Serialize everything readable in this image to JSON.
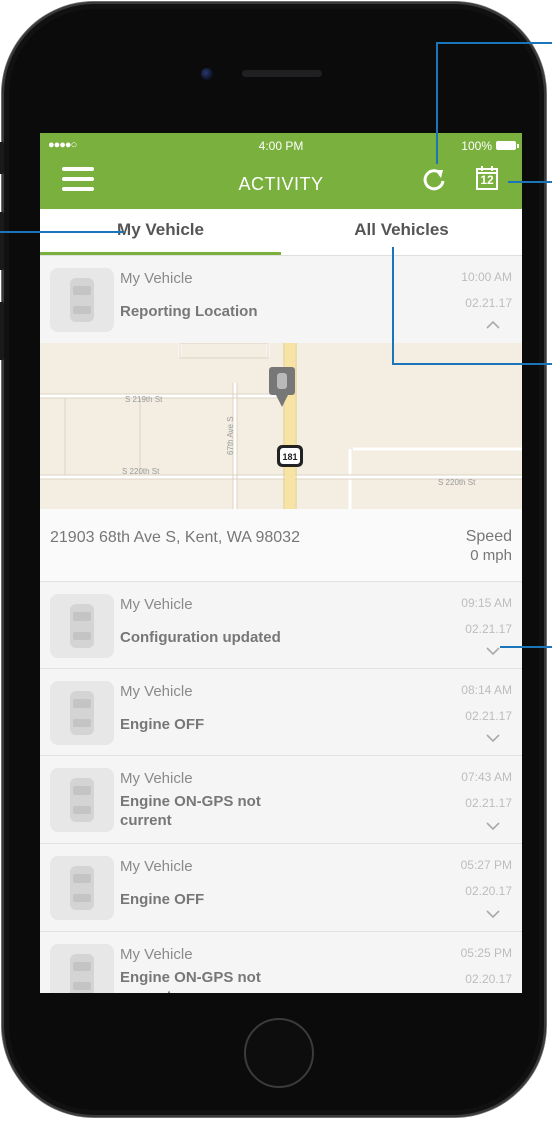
{
  "status_bar": {
    "signal": "●●●●○",
    "time": "4:00 PM",
    "battery": "100%"
  },
  "header": {
    "title": "ACTIVITY",
    "calendar_day": "12"
  },
  "tabs": [
    {
      "label": "My Vehicle"
    },
    {
      "label": "All Vehicles"
    }
  ],
  "expanded": {
    "name": "My Vehicle",
    "event": "Reporting Location",
    "time": "10:00 AM",
    "date": "02.21.17",
    "map": {
      "street_1": "S 219th St",
      "street_2": "S 220th St",
      "street_3": "S 220th St",
      "avenue": "67th Ave S",
      "route": "181"
    },
    "address": "21903 68th Ave S, Kent, WA 98032",
    "speed_label": "Speed",
    "speed_value": "0 mph"
  },
  "items": [
    {
      "name": "My Vehicle",
      "event": "Configuration updated",
      "time": "09:15 AM",
      "date": "02.21.17"
    },
    {
      "name": "My Vehicle",
      "event": "Engine OFF",
      "time": "08:14 AM",
      "date": "02.21.17"
    },
    {
      "name": "My Vehicle",
      "event": "Engine ON-GPS not current",
      "time": "07:43 AM",
      "date": "02.21.17"
    },
    {
      "name": "My Vehicle",
      "event": "Engine OFF",
      "time": "05:27 PM",
      "date": "02.20.17"
    },
    {
      "name": "My Vehicle",
      "event": "Engine ON-GPS not current",
      "time": "05:25 PM",
      "date": "02.20.17"
    }
  ],
  "colors": {
    "accent": "#7ab03d",
    "callout": "#1b75bb"
  }
}
